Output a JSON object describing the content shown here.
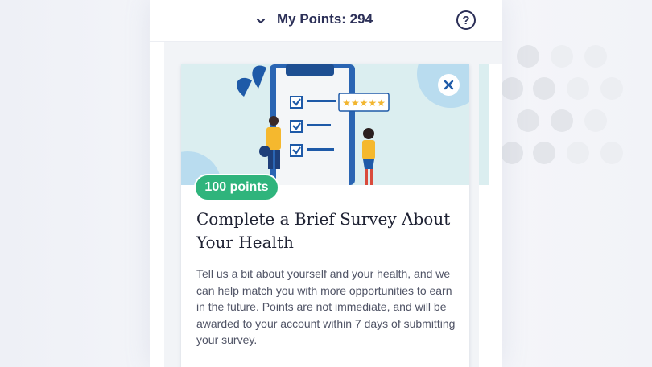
{
  "header": {
    "points_text": "My Points: 294",
    "help_glyph": "?",
    "toggle_icon": "chevron-down-icon",
    "help_icon": "question-circle-icon"
  },
  "card": {
    "illustration": "survey-clipboard-illustration",
    "close_icon": "close-icon",
    "badge": "100 points",
    "title": "Complete a Brief Survey About Your Health",
    "description": "Tell us a bit about yourself and your health, and we can help match you with more opportunities to earn in the future. Points are not immediate, and will be awarded to your account within 7 days of submitting your survey."
  },
  "colors": {
    "brand_navy": "#2b2f57",
    "badge_green": "#2fb47c",
    "illustration_bg": "#dbeef0",
    "accent_blue": "#1e5aa8"
  }
}
